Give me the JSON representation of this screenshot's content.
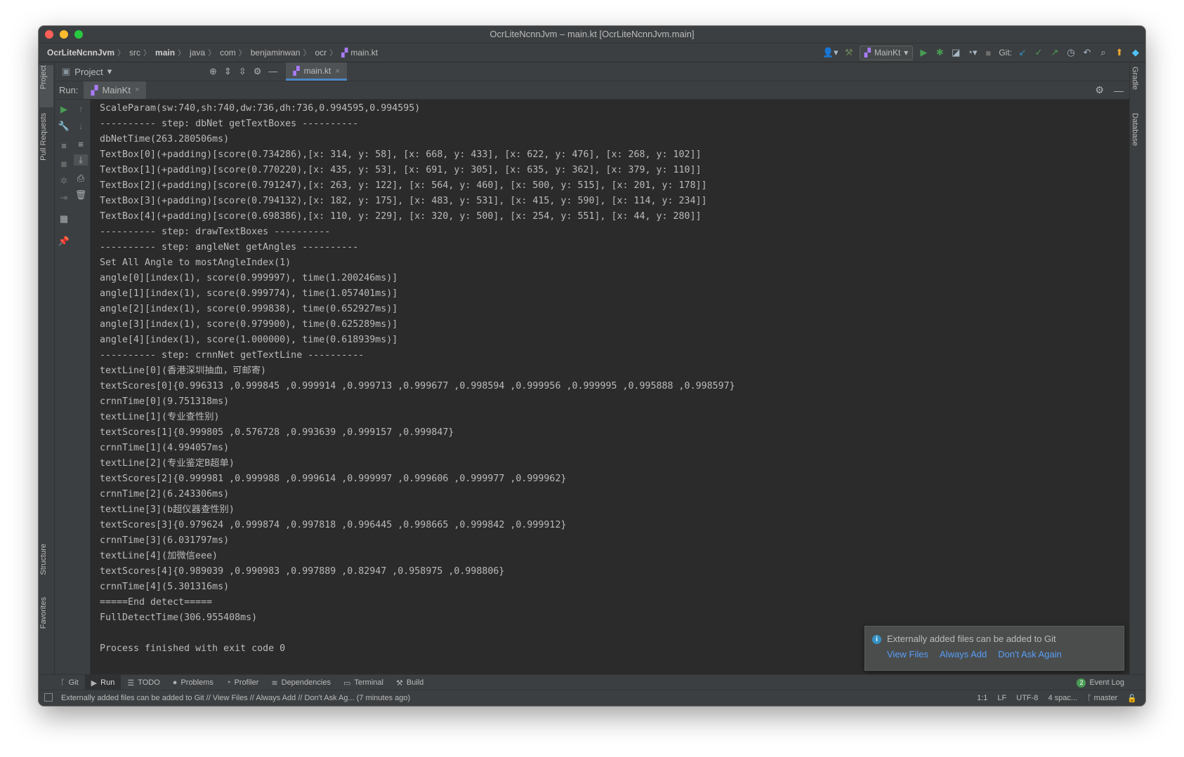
{
  "window": {
    "title": "OcrLiteNcnnJvm – main.kt [OcrLiteNcnnJvm.main]"
  },
  "colors": {
    "close": "#ff5f57",
    "minimize": "#febc2e",
    "zoom": "#28c840",
    "accent": "#4a88c7",
    "link": "#589df6"
  },
  "breadcrumb": [
    "OcrLiteNcnnJvm",
    "src",
    "main",
    "java",
    "com",
    "benjaminwan",
    "ocr",
    "main.kt"
  ],
  "toolbar": {
    "run_config": "MainKt",
    "git_label": "Git:"
  },
  "project_panel": {
    "title": "Project"
  },
  "editor": {
    "active_tab": "main.kt"
  },
  "run_panel": {
    "label": "Run:",
    "tab": "MainKt"
  },
  "left_tabs": {
    "project": "Project",
    "pull_requests": "Pull Requests",
    "structure": "Structure",
    "favorites": "Favorites"
  },
  "right_tabs": {
    "gradle": "Gradle",
    "database": "Database"
  },
  "console_lines": [
    "ScaleParam(sw:740,sh:740,dw:736,dh:736,0.994595,0.994595)",
    "---------- step: dbNet getTextBoxes ----------",
    "dbNetTime(263.280506ms)",
    "TextBox[0](+padding)[score(0.734286),[x: 314, y: 58], [x: 668, y: 433], [x: 622, y: 476], [x: 268, y: 102]]",
    "TextBox[1](+padding)[score(0.770220),[x: 435, y: 53], [x: 691, y: 305], [x: 635, y: 362], [x: 379, y: 110]]",
    "TextBox[2](+padding)[score(0.791247),[x: 263, y: 122], [x: 564, y: 460], [x: 500, y: 515], [x: 201, y: 178]]",
    "TextBox[3](+padding)[score(0.794132),[x: 182, y: 175], [x: 483, y: 531], [x: 415, y: 590], [x: 114, y: 234]]",
    "TextBox[4](+padding)[score(0.698386),[x: 110, y: 229], [x: 320, y: 500], [x: 254, y: 551], [x: 44, y: 280]]",
    "---------- step: drawTextBoxes ----------",
    "---------- step: angleNet getAngles ----------",
    "Set All Angle to mostAngleIndex(1)",
    "angle[0][index(1), score(0.999997), time(1.200246ms)]",
    "angle[1][index(1), score(0.999774), time(1.057401ms)]",
    "angle[2][index(1), score(0.999838), time(0.652927ms)]",
    "angle[3][index(1), score(0.979900), time(0.625289ms)]",
    "angle[4][index(1), score(1.000000), time(0.618939ms)]",
    "---------- step: crnnNet getTextLine ----------",
    "textLine[0](香港深圳抽血，可邮寄)",
    "textScores[0]{0.996313 ,0.999845 ,0.999914 ,0.999713 ,0.999677 ,0.998594 ,0.999956 ,0.999995 ,0.995888 ,0.998597}",
    "crnnTime[0](9.751318ms)",
    "textLine[1](专业查性别)",
    "textScores[1]{0.999805 ,0.576728 ,0.993639 ,0.999157 ,0.999847}",
    "crnnTime[1](4.994057ms)",
    "textLine[2](专业鉴定B超单)",
    "textScores[2]{0.999981 ,0.999988 ,0.999614 ,0.999997 ,0.999606 ,0.999977 ,0.999962}",
    "crnnTime[2](6.243306ms)",
    "textLine[3](b超仪器查性别)",
    "textScores[3]{0.979624 ,0.999874 ,0.997818 ,0.996445 ,0.998665 ,0.999842 ,0.999912}",
    "crnnTime[3](6.031797ms)",
    "textLine[4](加微信eee)",
    "textScores[4]{0.989039 ,0.990983 ,0.997889 ,0.82947 ,0.958975 ,0.998806}",
    "crnnTime[4](5.301316ms)",
    "=====End detect=====",
    "FullDetectTime(306.955408ms)",
    "",
    "Process finished with exit code 0"
  ],
  "notification": {
    "message": "Externally added files can be added to Git",
    "actions": [
      "View Files",
      "Always Add",
      "Don't Ask Again"
    ]
  },
  "bottom_tabs": [
    "Git",
    "Run",
    "TODO",
    "Problems",
    "Profiler",
    "Dependencies",
    "Terminal",
    "Build"
  ],
  "event_log": {
    "label": "Event Log",
    "count": "2"
  },
  "status": {
    "message": "Externally added files can be added to Git // View Files // Always Add // Don't Ask Ag... (7 minutes ago)",
    "position": "1:1",
    "line_sep": "LF",
    "encoding": "UTF-8",
    "indent": "4 spac...",
    "branch": "master"
  }
}
